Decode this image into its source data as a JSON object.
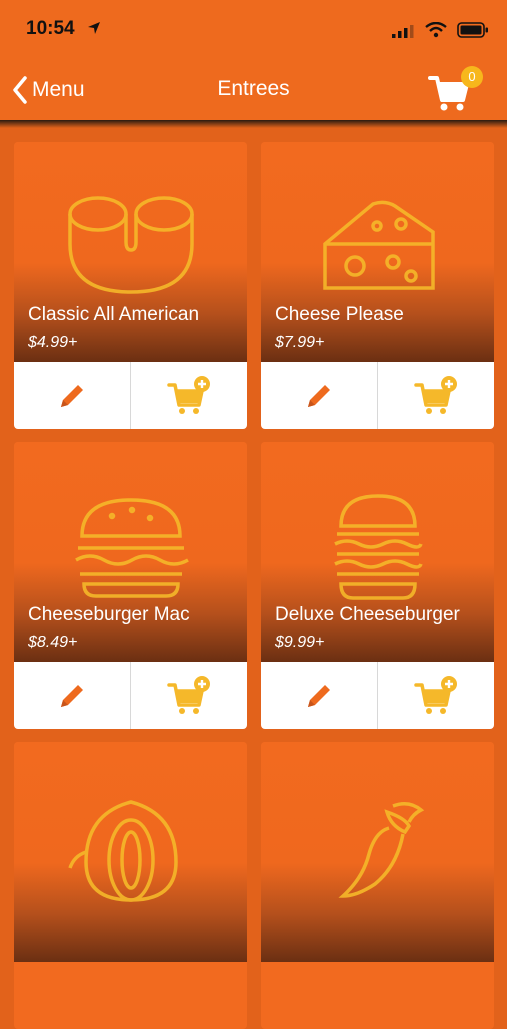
{
  "status_bar": {
    "time": "10:54"
  },
  "nav": {
    "back_label": "Menu",
    "title": "Entrees",
    "cart_count": "0"
  },
  "colors": {
    "brand": "#EE6A1E",
    "accent": "#F7B71C",
    "icon_yellow": "#F5B82A"
  },
  "items": [
    {
      "name": "Classic All American",
      "price": "$4.99+",
      "icon": "macaroni-icon"
    },
    {
      "name": "Cheese Please",
      "price": "$7.99+",
      "icon": "cheese-icon"
    },
    {
      "name": "Cheeseburger Mac",
      "price": "$8.49+",
      "icon": "burger-icon"
    },
    {
      "name": "Deluxe Cheeseburger",
      "price": "$9.99+",
      "icon": "double-burger-icon"
    },
    {
      "name": "",
      "price": "",
      "icon": "onion-icon"
    },
    {
      "name": "",
      "price": "",
      "icon": "pepper-icon"
    }
  ]
}
